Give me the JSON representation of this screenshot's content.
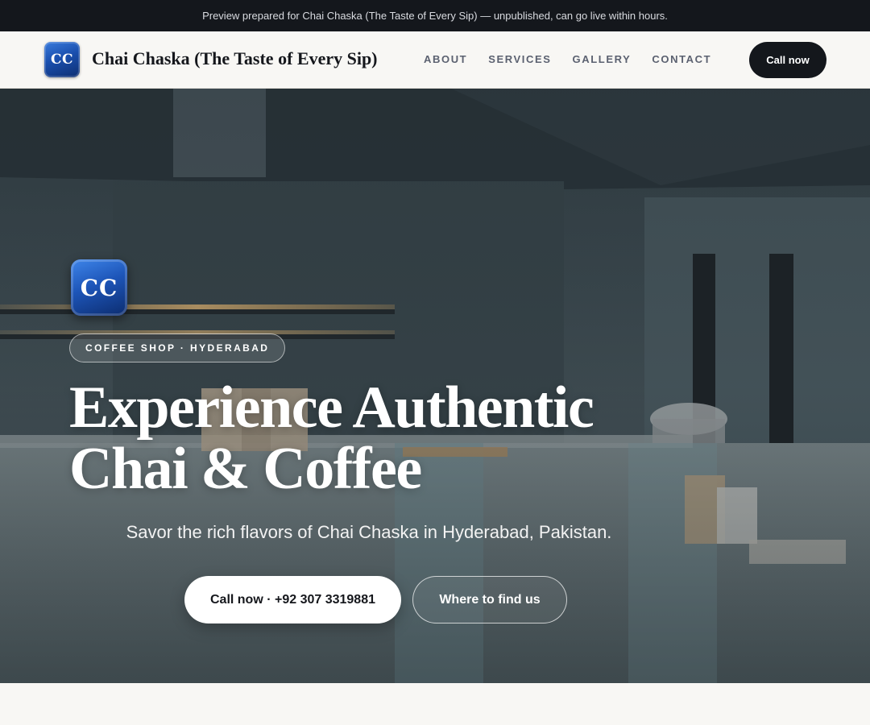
{
  "preview_bar": {
    "text": "Preview prepared for Chai Chaska (The Taste of Every Sip) — unpublished, can go live within hours."
  },
  "header": {
    "logo_text": "CC",
    "brand_name": "Chai Chaska (The Taste of Every Sip)",
    "nav": [
      "ABOUT",
      "SERVICES",
      "GALLERY",
      "CONTACT"
    ],
    "call_label": "Call now"
  },
  "hero": {
    "logo_text": "CC",
    "badge": "COFFEE SHOP · HYDERABAD",
    "title": "Experience Authentic Chai & Coffee",
    "subtitle": "Savor the rich flavors of Chai Chaska in Hyderabad, Pakistan.",
    "primary_cta": "Call now · +92 307 3319881",
    "secondary_cta": "Where to find us"
  },
  "colors": {
    "dark": "#14171c",
    "page_bg": "#f8f7f4",
    "logo_blue": "#1a4fae"
  }
}
